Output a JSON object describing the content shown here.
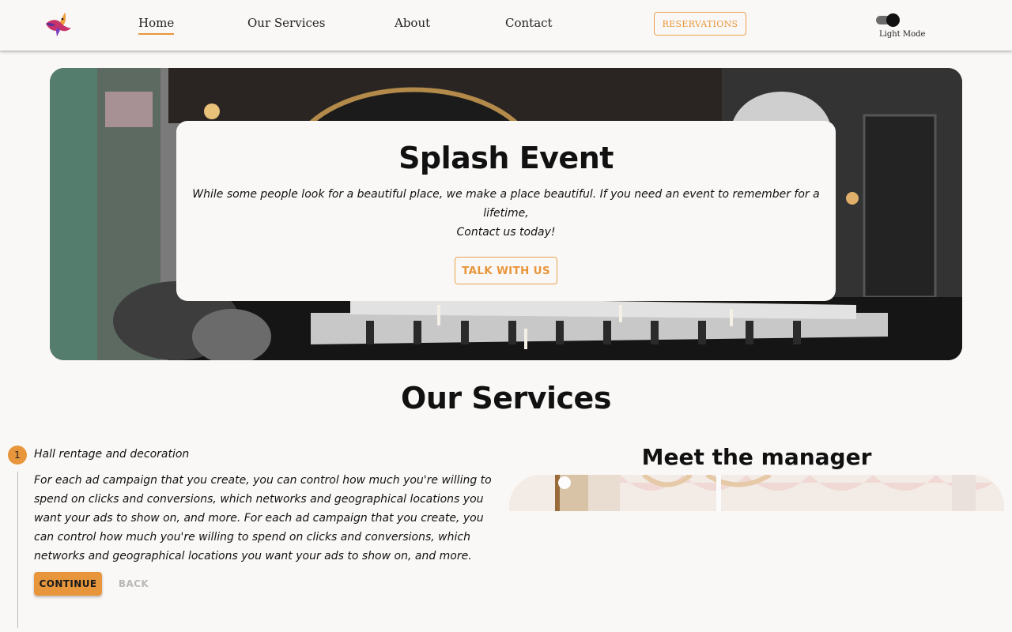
{
  "header": {
    "nav": [
      {
        "label": "Home",
        "active": true
      },
      {
        "label": "Our Services",
        "active": false
      },
      {
        "label": "About",
        "active": false
      },
      {
        "label": "Contact",
        "active": false
      }
    ],
    "reservations_label": "RESERVATIONS",
    "theme_toggle_label": "Light Mode"
  },
  "hero": {
    "title": "Splash Event",
    "line1": "While some people look for a beautiful place, we make a place beautiful. If you need an event to remember for a lifetime,",
    "line2": "Contact us today!",
    "cta_label": "TALK WITH US"
  },
  "services": {
    "title": "Our Services",
    "step": {
      "number": "1",
      "label": "Hall rentage and decoration",
      "description": "For each ad campaign that you create, you can control how much you're willing to spend on clicks and conversions, which networks and geographical locations you want your ads to show on, and more. For each ad campaign that you create, you can control how much you're willing to spend on clicks and conversions, which networks and geographical locations you want your ads to show on, and more."
    },
    "continue_label": "CONTINUE",
    "back_label": "BACK"
  },
  "manager": {
    "title": "Meet the manager"
  },
  "colors": {
    "accent": "#e8963c",
    "background": "#faf8f6"
  }
}
